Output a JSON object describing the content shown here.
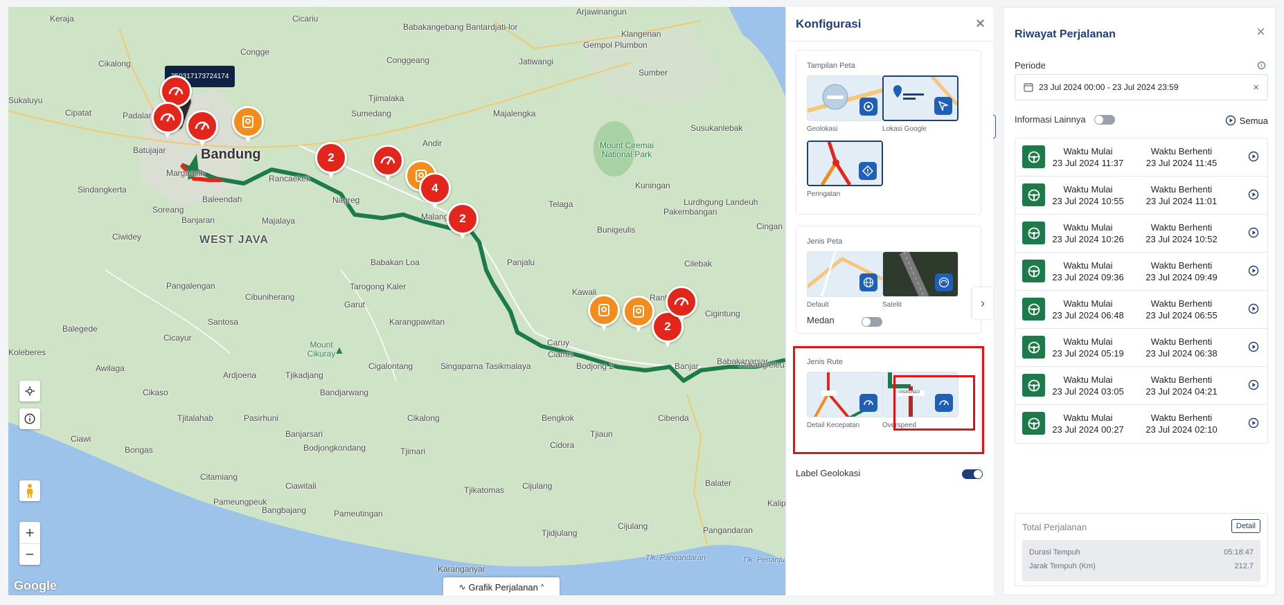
{
  "map": {
    "plate_tooltip": "350317173724174",
    "places": [
      {
        "name": "Keraja"
      },
      {
        "name": "Cicariu"
      },
      {
        "name": "Babakangebang Bantardjati-lor"
      },
      {
        "name": "Arjawinangun"
      },
      {
        "name": "Klangenan"
      },
      {
        "name": "Gempol Plumbon"
      },
      {
        "name": "Congge"
      },
      {
        "name": "Conggeang"
      },
      {
        "name": "Jatiwangi"
      },
      {
        "name": "Cikalong"
      },
      {
        "name": "Sumber"
      },
      {
        "name": "Sukaluyu"
      },
      {
        "name": "Tjimalaka"
      },
      {
        "name": "Cipatat"
      },
      {
        "name": "Padalarang"
      },
      {
        "name": "Sumedang"
      },
      {
        "name": "Majalengka"
      },
      {
        "name": "Susukanlebak"
      },
      {
        "name": "Batujajar"
      },
      {
        "name": "Andir"
      },
      {
        "name": "Rancaekek"
      },
      {
        "name": "Margaasih"
      },
      {
        "name": "Sindangkerta"
      },
      {
        "name": "Baleendah"
      },
      {
        "name": "Soreang"
      },
      {
        "name": "Banjaran"
      },
      {
        "name": "Majalaya"
      },
      {
        "name": "Nagreg"
      },
      {
        "name": "Kuningan"
      },
      {
        "name": "Lurdhgung Landeuh"
      },
      {
        "name": "Telaga"
      },
      {
        "name": "Pakembangan"
      },
      {
        "name": "Cingan"
      },
      {
        "name": "Ciwidey"
      },
      {
        "name": "WEST JAVA"
      },
      {
        "name": "Bunigeulis"
      },
      {
        "name": "Malangbong"
      },
      {
        "name": "Cilebak"
      },
      {
        "name": "Babakan Loa"
      },
      {
        "name": "Panjalu"
      },
      {
        "name": "Pangalengan"
      },
      {
        "name": "Cibuniherang"
      },
      {
        "name": "Tarogong Kaler"
      },
      {
        "name": "Garut"
      },
      {
        "name": "Kawali"
      },
      {
        "name": "Rantjah"
      },
      {
        "name": "Santosa"
      },
      {
        "name": "Cigintung"
      },
      {
        "name": "Balegede"
      },
      {
        "name": "Cicayur"
      },
      {
        "name": "Karangpawitan"
      },
      {
        "name": "Caruy"
      },
      {
        "name": "Ciamis"
      },
      {
        "name": "Koleberes"
      },
      {
        "name": "Awilaga"
      },
      {
        "name": "Ardjoena"
      },
      {
        "name": "Tjikadjang"
      },
      {
        "name": "Cigalontang"
      },
      {
        "name": "Singaparna Tasikmalaya"
      },
      {
        "name": "Bodjong 2"
      },
      {
        "name": "Banjar"
      },
      {
        "name": "Babakananjar"
      },
      {
        "name": "Cukangleleus"
      },
      {
        "name": "Cikaso"
      },
      {
        "name": "Bandjarwang"
      },
      {
        "name": "Tjitalahab"
      },
      {
        "name": "Pasirhuni"
      },
      {
        "name": "Cikalong"
      },
      {
        "name": "Bengkok"
      },
      {
        "name": "Cibenda"
      },
      {
        "name": "Banjarsari"
      },
      {
        "name": "Tjiaun"
      },
      {
        "name": "Ciawi"
      },
      {
        "name": "Bodjongkondang"
      },
      {
        "name": "Cidora"
      },
      {
        "name": "Bongas"
      },
      {
        "name": "Tjimari"
      },
      {
        "name": "Citamiang"
      },
      {
        "name": "Ciawitali"
      },
      {
        "name": "Tjikatomas"
      },
      {
        "name": "Cijulang"
      },
      {
        "name": "Balater"
      },
      {
        "name": "Pameungpeuk"
      },
      {
        "name": "Bangbajang"
      },
      {
        "name": "Pameutingan"
      },
      {
        "name": "Pangandaran"
      },
      {
        "name": "Tjidjulang"
      },
      {
        "name": "Cijulang"
      },
      {
        "name": "Karanganyar"
      },
      {
        "name": "Tlk. Pangandaran"
      },
      {
        "name": "Tlk. Penanjung"
      },
      {
        "name": "Kaliputih"
      }
    ],
    "big_city": "Bandung",
    "parks": [
      {
        "name": "Mount Ciremai National Park"
      },
      {
        "name": "Mount Cikuray"
      }
    ],
    "markers": [
      {
        "kind": "overspeed",
        "color": "red",
        "label": ""
      },
      {
        "kind": "overspeed",
        "color": "red",
        "label": ""
      },
      {
        "kind": "overspeed",
        "color": "red",
        "label": ""
      },
      {
        "kind": "geofence",
        "color": "orange",
        "label": ""
      },
      {
        "kind": "cluster",
        "color": "red",
        "label": "2"
      },
      {
        "kind": "overspeed",
        "color": "red",
        "label": ""
      },
      {
        "kind": "geofence",
        "color": "orange",
        "label": ""
      },
      {
        "kind": "cluster",
        "color": "red",
        "label": "4"
      },
      {
        "kind": "cluster",
        "color": "red",
        "label": "2"
      },
      {
        "kind": "geofence",
        "color": "orange",
        "label": ""
      },
      {
        "kind": "geofence",
        "color": "orange",
        "label": ""
      },
      {
        "kind": "cluster",
        "color": "red",
        "label": "2"
      },
      {
        "kind": "overspeed",
        "color": "red",
        "label": ""
      }
    ],
    "google_label": "Google",
    "grafik_label": "Grafik Perjalanan",
    "route_color": "#1d7a4a",
    "overspeed_color": "#e3261b"
  },
  "konfigurasi": {
    "title": "Konfigurasi",
    "tampilan_peta": {
      "title": "Tampilan Peta",
      "options": [
        {
          "label": "Geolokasi",
          "icon": "target-icon"
        },
        {
          "label": "Lokasi Google",
          "icon": "cursor-icon"
        },
        {
          "label": "Peringatan",
          "icon": "warning-icon"
        }
      ]
    },
    "jenis_peta": {
      "title": "Jenis Peta",
      "options": [
        {
          "label": "Default",
          "icon": "globe-icon"
        },
        {
          "label": "Satelit",
          "icon": "satellite-icon"
        }
      ],
      "medan_label": "Medan",
      "medan_on": false
    },
    "jenis_rute": {
      "title": "Jenis Rute",
      "options": [
        {
          "label": "Detail Kecepatan",
          "icon": "speedometer-icon"
        },
        {
          "label": "Overspeed",
          "icon": "speedometer-icon"
        }
      ],
      "overspeed_tag": "OVERSPEED"
    },
    "label_geolokasi": "Label Geolokasi",
    "label_geolokasi_on": true
  },
  "riwayat": {
    "title": "Riwayat Perjalanan",
    "periode_label": "Periode",
    "periode_value": "23 Jul 2024 00:00 - 23 Jul 2024 23:59",
    "informasi_label": "Informasi Lainnya",
    "semua_label": "Semua",
    "start_header": "Waktu Mulai",
    "end_header": "Waktu Berhenti",
    "trips": [
      {
        "start": "23 Jul 2024 11:37",
        "end": "23 Jul 2024 11:45"
      },
      {
        "start": "23 Jul 2024 10:55",
        "end": "23 Jul 2024 11:01"
      },
      {
        "start": "23 Jul 2024 10:26",
        "end": "23 Jul 2024 10:52"
      },
      {
        "start": "23 Jul 2024 09:36",
        "end": "23 Jul 2024 09:49"
      },
      {
        "start": "23 Jul 2024 06:48",
        "end": "23 Jul 2024 06:55"
      },
      {
        "start": "23 Jul 2024 05:19",
        "end": "23 Jul 2024 06:38"
      },
      {
        "start": "23 Jul 2024 03:05",
        "end": "23 Jul 2024 04:21"
      },
      {
        "start": "23 Jul 2024 00:27",
        "end": "23 Jul 2024 02:10"
      }
    ],
    "total": {
      "title": "Total Perjalanan",
      "detail_label": "Detail",
      "durasi_label": "Durasi Tempuh",
      "durasi_value": "05:18:47",
      "jarak_label": "Jarak Tempuh (Km)",
      "jarak_value": "212.7"
    }
  }
}
